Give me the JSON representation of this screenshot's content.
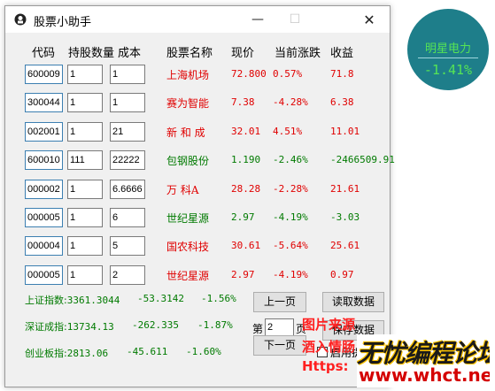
{
  "window": {
    "title": "股票小助手",
    "minimize": "—",
    "maximize": "☐",
    "close": "✕"
  },
  "headers": {
    "code": "代码",
    "qty": "持股数量",
    "cost": "成本",
    "name": "股票名称",
    "price": "现价",
    "change": "当前涨跌",
    "profit": "收益"
  },
  "rows": [
    {
      "code": "600009",
      "qty": "1",
      "cost": "1",
      "name": "上海机场",
      "price": "72.800",
      "change": "0.57%",
      "profit": "71.8",
      "color": "red"
    },
    {
      "code": "300044",
      "qty": "1",
      "cost": "1",
      "name": "赛为智能",
      "price": "7.38",
      "change": "-4.28%",
      "profit": "6.38",
      "color": "red"
    },
    {
      "code": "002001",
      "qty": "1",
      "cost": "21",
      "name": "新 和 成",
      "price": "32.01",
      "change": "4.51%",
      "profit": "11.01",
      "color": "red"
    },
    {
      "code": "600010",
      "qty": "111",
      "cost": "22222",
      "name": "包钢股份",
      "price": "1.190",
      "change": "-2.46%",
      "profit": "-2466509.91",
      "color": "green"
    },
    {
      "code": "000002",
      "qty": "1",
      "cost": "6.6666",
      "name": "万 科A",
      "price": "28.28",
      "change": "-2.28%",
      "profit": "21.61",
      "color": "red"
    },
    {
      "code": "000005",
      "qty": "1",
      "cost": "6",
      "name": "世纪星源",
      "price": "2.97",
      "change": "-4.19%",
      "profit": "-3.03",
      "color": "green"
    },
    {
      "code": "000004",
      "qty": "1",
      "cost": "5",
      "name": "国农科技",
      "price": "30.61",
      "change": "-5.64%",
      "profit": "25.61",
      "color": "red"
    },
    {
      "code": "000005",
      "qty": "1",
      "cost": "2",
      "name": "世纪星源",
      "price": "2.97",
      "change": "-4.19%",
      "profit": "0.97",
      "color": "red"
    }
  ],
  "indices": [
    {
      "label": "上证指数:",
      "value": "3361.3044",
      "change": "-53.3142",
      "pct": "-1.56%"
    },
    {
      "label": "深证成指:",
      "value": "13734.13",
      "change": "-262.335",
      "pct": "-1.87%"
    },
    {
      "label": "创业板指:",
      "value": "2813.06",
      "change": "-45.611",
      "pct": "-1.60%"
    }
  ],
  "buttons": {
    "prev": "上一页",
    "next": "下一页",
    "read": "读取数据",
    "save": "保存数据"
  },
  "pager": {
    "prefix": "第",
    "page": "2",
    "suffix": "页"
  },
  "checkbox_label": "启用提",
  "widget": {
    "name": "明星电力",
    "value": "-1.41%"
  },
  "watermark": {
    "source_line1": "图片来源",
    "source_line2": "酒入情肠",
    "url_prefix": "Https:",
    "banner_big": "无忧编程论坛",
    "banner_small": "www.whct.net"
  },
  "colors": {
    "red": "#e00000",
    "green": "#007a00",
    "widget_bg": "#1e7e8a",
    "widget_text": "#55e455"
  }
}
